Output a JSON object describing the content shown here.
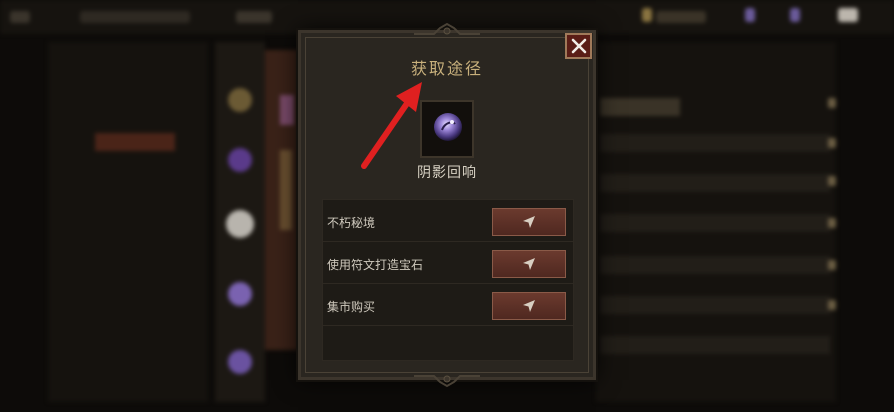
{
  "dialog": {
    "title": "获取途径",
    "close_icon": "close-icon",
    "item": {
      "name": "阴影回响",
      "icon": "purple-orb-icon"
    },
    "sources": [
      {
        "label": "不朽秘境",
        "action_icon": "send-arrow-icon"
      },
      {
        "label": "使用符文打造宝石",
        "action_icon": "send-arrow-icon"
      },
      {
        "label": "集市购买",
        "action_icon": "send-arrow-icon"
      }
    ]
  },
  "annotation": {
    "icon": "red-arrow-icon",
    "color": "#e02020"
  },
  "colors": {
    "title": "#c8b07c",
    "button": "#5a2e24",
    "close": "#5a1d16",
    "panel": "#2a2620"
  }
}
